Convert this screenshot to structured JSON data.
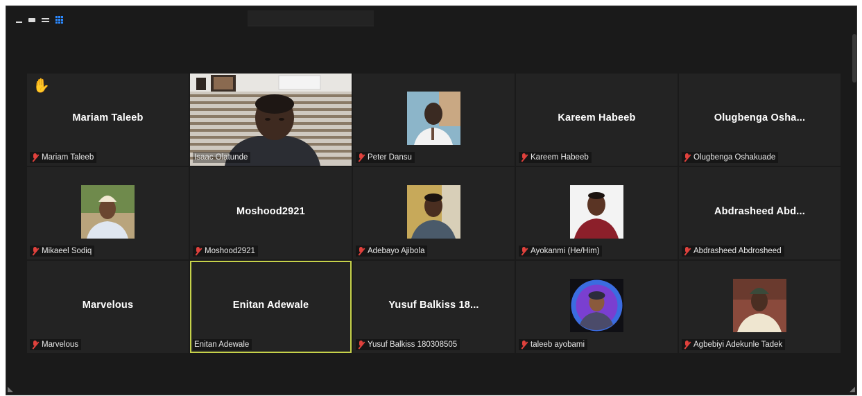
{
  "toolbar": {
    "icons": [
      "minimize-icon",
      "speaker-view-icon",
      "list-view-icon",
      "gallery-view-icon"
    ]
  },
  "participants": [
    {
      "title": "Mariam Taleeb",
      "label": "Mariam Taleeb",
      "muted": true,
      "raised_hand": true
    },
    {
      "title": "",
      "label": "Isaac Olatunde",
      "muted": false,
      "video": true
    },
    {
      "title": "",
      "label": "Peter Dansu",
      "muted": true,
      "photo": "man-in-white-shirt"
    },
    {
      "title": "Kareem Habeeb",
      "label": "Kareem Habeeb",
      "muted": true
    },
    {
      "title": "Olugbenga Osha...",
      "label": "Olugbenga Oshakuade",
      "muted": true
    },
    {
      "title": "",
      "label": "Mikaeel Sodiq",
      "muted": true,
      "photo": "man-with-cap"
    },
    {
      "title": "Moshood2921",
      "label": "Moshood2921",
      "muted": true
    },
    {
      "title": "",
      "label": "Adebayo Ajibola",
      "muted": true,
      "photo": "smiling-man"
    },
    {
      "title": "",
      "label": "Ayokanmi (He/Him)",
      "muted": true,
      "photo": "man-in-red"
    },
    {
      "title": "Abdrasheed Abd...",
      "label": "Abdrasheed Abdrosheed",
      "muted": true
    },
    {
      "title": "Marvelous",
      "label": "Marvelous",
      "muted": true
    },
    {
      "title": "Enitan Adewale",
      "label": "Enitan Adewale",
      "muted": false,
      "active_speaker": true
    },
    {
      "title": "Yusuf Balkiss 18...",
      "label": "Yusuf Balkiss 180308505",
      "muted": true
    },
    {
      "title": "",
      "label": "taleeb ayobami",
      "muted": true,
      "photo": "cartoon-avatar"
    },
    {
      "title": "",
      "label": "Agbebiyi Adekunle Tadek",
      "muted": true,
      "photo": "man-in-traditional-cap"
    }
  ],
  "colors": {
    "background": "#1a1a1a",
    "tile": "#232323",
    "active_border": "#c6d24a",
    "muted_mic": "#e0413c",
    "raised_hand": "#f2b233",
    "gallery_icon": "#2b89ff"
  }
}
